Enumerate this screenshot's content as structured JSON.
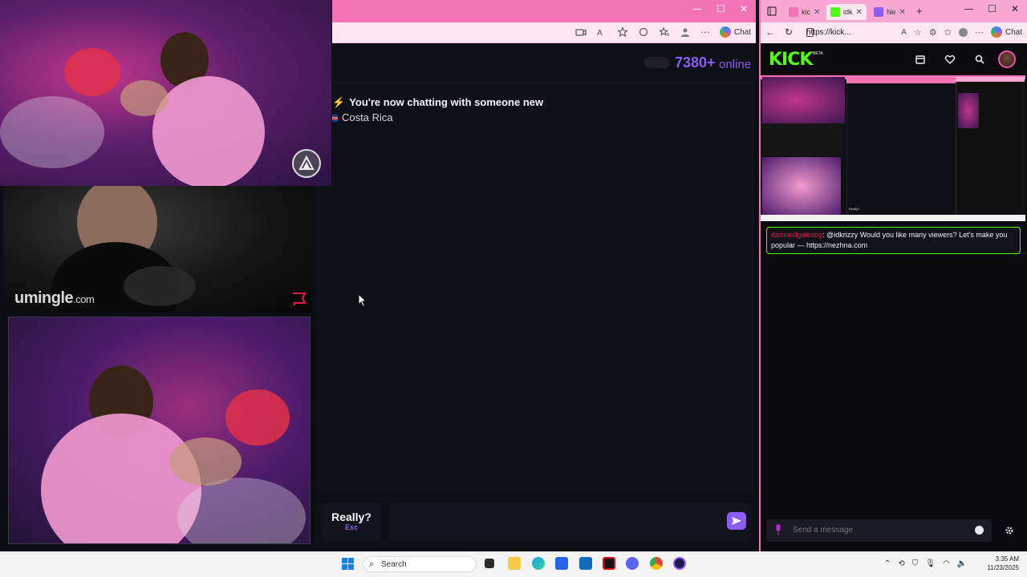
{
  "umingle": {
    "online_count": "7380+",
    "online_label": "online",
    "system_message": "You're now chatting with someone new",
    "country": "Costa Rica",
    "logo_text": "umingle",
    "logo_domain": ".com",
    "really_label": "Really?",
    "really_key": "Esc",
    "message_placeholder": ""
  },
  "left_browser": {
    "copilot_label": "Chat",
    "min": "—",
    "max": "☐",
    "close": "✕"
  },
  "right_browser": {
    "tabs": [
      {
        "label": "kic",
        "favicon_color": "#f472b6"
      },
      {
        "label": "idk",
        "favicon_color": "#53fc18"
      },
      {
        "label": "Ne",
        "favicon_color": "#8b5cf6"
      }
    ],
    "url": "https://kick...",
    "copilot_label": "Chat",
    "min": "—",
    "max": "☐",
    "close": "✕"
  },
  "kick": {
    "logo": "KICK",
    "beta": "BETA",
    "chat": {
      "username": "damnedgalexog",
      "message": ": @idkrizzy Would you like many viewers? Let's make you popular — https://nezhna.com"
    },
    "composer_placeholder": "Send a message",
    "accent": "#53fc18"
  },
  "preview": {
    "really_label": "Really?"
  },
  "taskbar": {
    "search_label": "Search",
    "time": "3:35 AM",
    "date": "11/23/2025",
    "apps": [
      "task-view-icon",
      "file-explorer-icon",
      "edge-icon",
      "store-icon",
      "outlook-icon",
      "netflix-icon",
      "discord-icon",
      "chrome-icon",
      "app-icon"
    ]
  },
  "colors": {
    "umingle_accent": "#8b5cf6",
    "browser_pink": "#f472b6",
    "kick_green": "#53fc18"
  }
}
